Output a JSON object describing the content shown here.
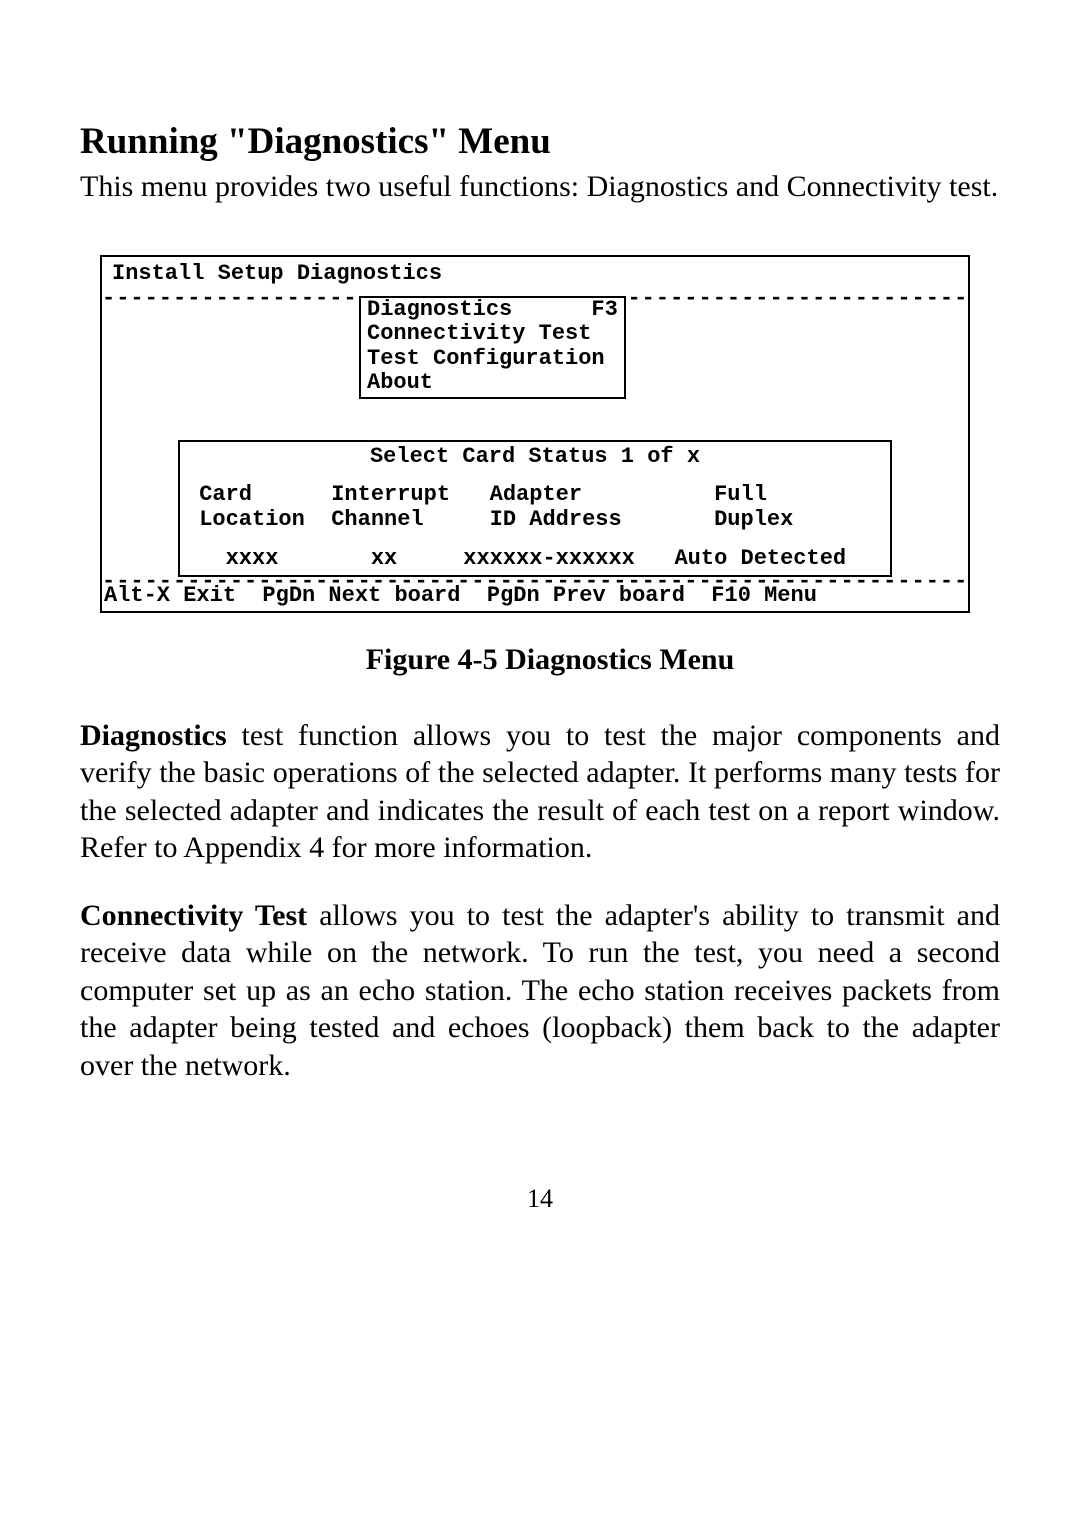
{
  "heading": "Running \"Diagnostics\" Menu",
  "intro": "This menu provides two useful functions: Diagnostics and Connectivity test.",
  "screenshot": {
    "menubar": "Install Setup Diagnostics",
    "dropdown": [
      "Diagnostics      F3",
      "Connectivity Test",
      "Test Configuration",
      "About"
    ],
    "status": {
      "title": "Select Card Status 1 of x",
      "header1": " Card      Interrupt   Adapter          Full",
      "header2": " Location  Channel     ID Address       Duplex",
      "row": "   xxxx       xx     xxxxxx-xxxxxx   Auto Detected"
    },
    "footer": "Alt-X Exit  PgDn Next board  PgDn Prev board  F10 Menu"
  },
  "caption": "Figure 4-5 Diagnostics Menu",
  "para1_lead": "Diagnostics",
  "para1_rest": " test function allows you to test the major components and verify the basic operations of the selected adapter. It performs many tests for the selected adapter and indicates the result of each test on a report window. Refer to Appendix 4 for more information.",
  "para2_lead": "Connectivity Test",
  "para2_rest": " allows you to test the adapter's ability to transmit and receive data while on the network. To run the test, you need a second computer set up as an echo station. The echo station receives packets from the adapter being tested and echoes (loopback) them back to the adapter over the network.",
  "page_number": "14",
  "dashes": "-----------------------------------------------------------------"
}
